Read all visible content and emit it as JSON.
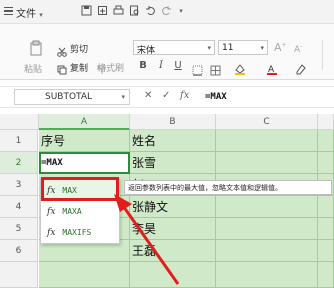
{
  "menubar": {
    "file_label": "文件",
    "file_caret": "▾"
  },
  "ribbon": {
    "paste_label": "粘贴",
    "cut_label": "剪切",
    "copy_label": "复制",
    "format_painter_label": "格式刷",
    "font_name": "宋体",
    "font_size": "11",
    "bold": "B",
    "italic": "I",
    "underline": "U"
  },
  "formula_bar": {
    "name_box": "SUBTOTAL",
    "cancel_glyph": "✕",
    "confirm_glyph": "✓",
    "fx_label": "fx",
    "content": "=MAX"
  },
  "columns": [
    "A",
    "B",
    "C"
  ],
  "rows": [
    "1",
    "2",
    "3",
    "4",
    "5",
    "6"
  ],
  "cells": {
    "A1": "序号",
    "B1": "姓名",
    "A2": "=MAX",
    "B2": "张雪",
    "B3": "赵",
    "B4": "张静文",
    "B5": "李昊",
    "B6": "王磊"
  },
  "autocomplete": {
    "items": [
      {
        "icon": "fx",
        "name": "MAX"
      },
      {
        "icon": "fx",
        "name": "MAXA"
      },
      {
        "icon": "fx",
        "name": "MAXIFS"
      }
    ],
    "tooltip": "返回参数列表中的最大值，忽略文本值和逻辑值。"
  },
  "colors": {
    "accent_green": "#2f8a3b",
    "highlight_red": "#e11d1d",
    "cell_fill": "#cfe9c9"
  }
}
